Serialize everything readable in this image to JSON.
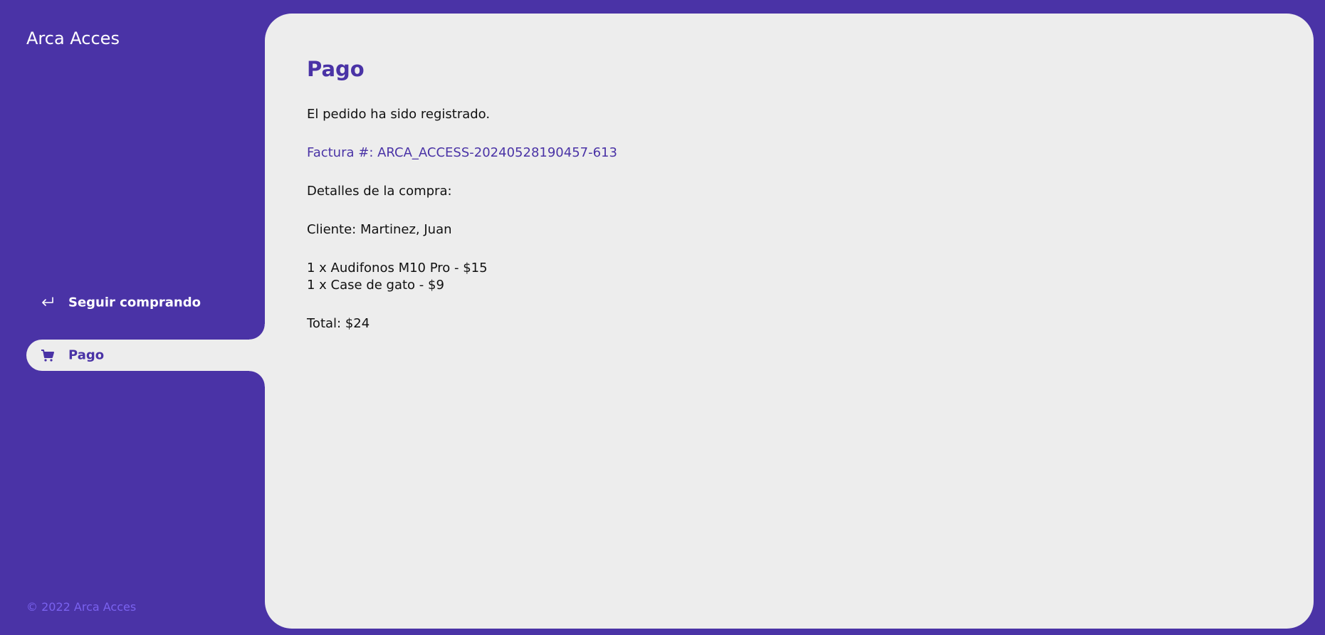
{
  "sidebar": {
    "brand": "Arca Acces",
    "nav": [
      {
        "label": "Seguir comprando",
        "icon": "return-arrow-icon"
      },
      {
        "label": "Pago",
        "icon": "cart-icon",
        "active": true
      }
    ],
    "footer": "© 2022 Arca Acces"
  },
  "main": {
    "title": "Pago",
    "status": "El pedido ha sido registrado.",
    "invoice": "Factura #: ARCA_ACCESS-20240528190457-613",
    "details_heading": "Detalles de la compra:",
    "client": "Cliente: Martinez, Juan",
    "items": [
      "1 x Audifonos M10 Pro - $15",
      "1 x Case de gato - $9"
    ],
    "total": "Total: $24"
  },
  "colors": {
    "brand_purple": "#4a33a6",
    "panel_bg": "#ededed",
    "footer_text": "#7a62ef",
    "body_text": "#111111"
  }
}
